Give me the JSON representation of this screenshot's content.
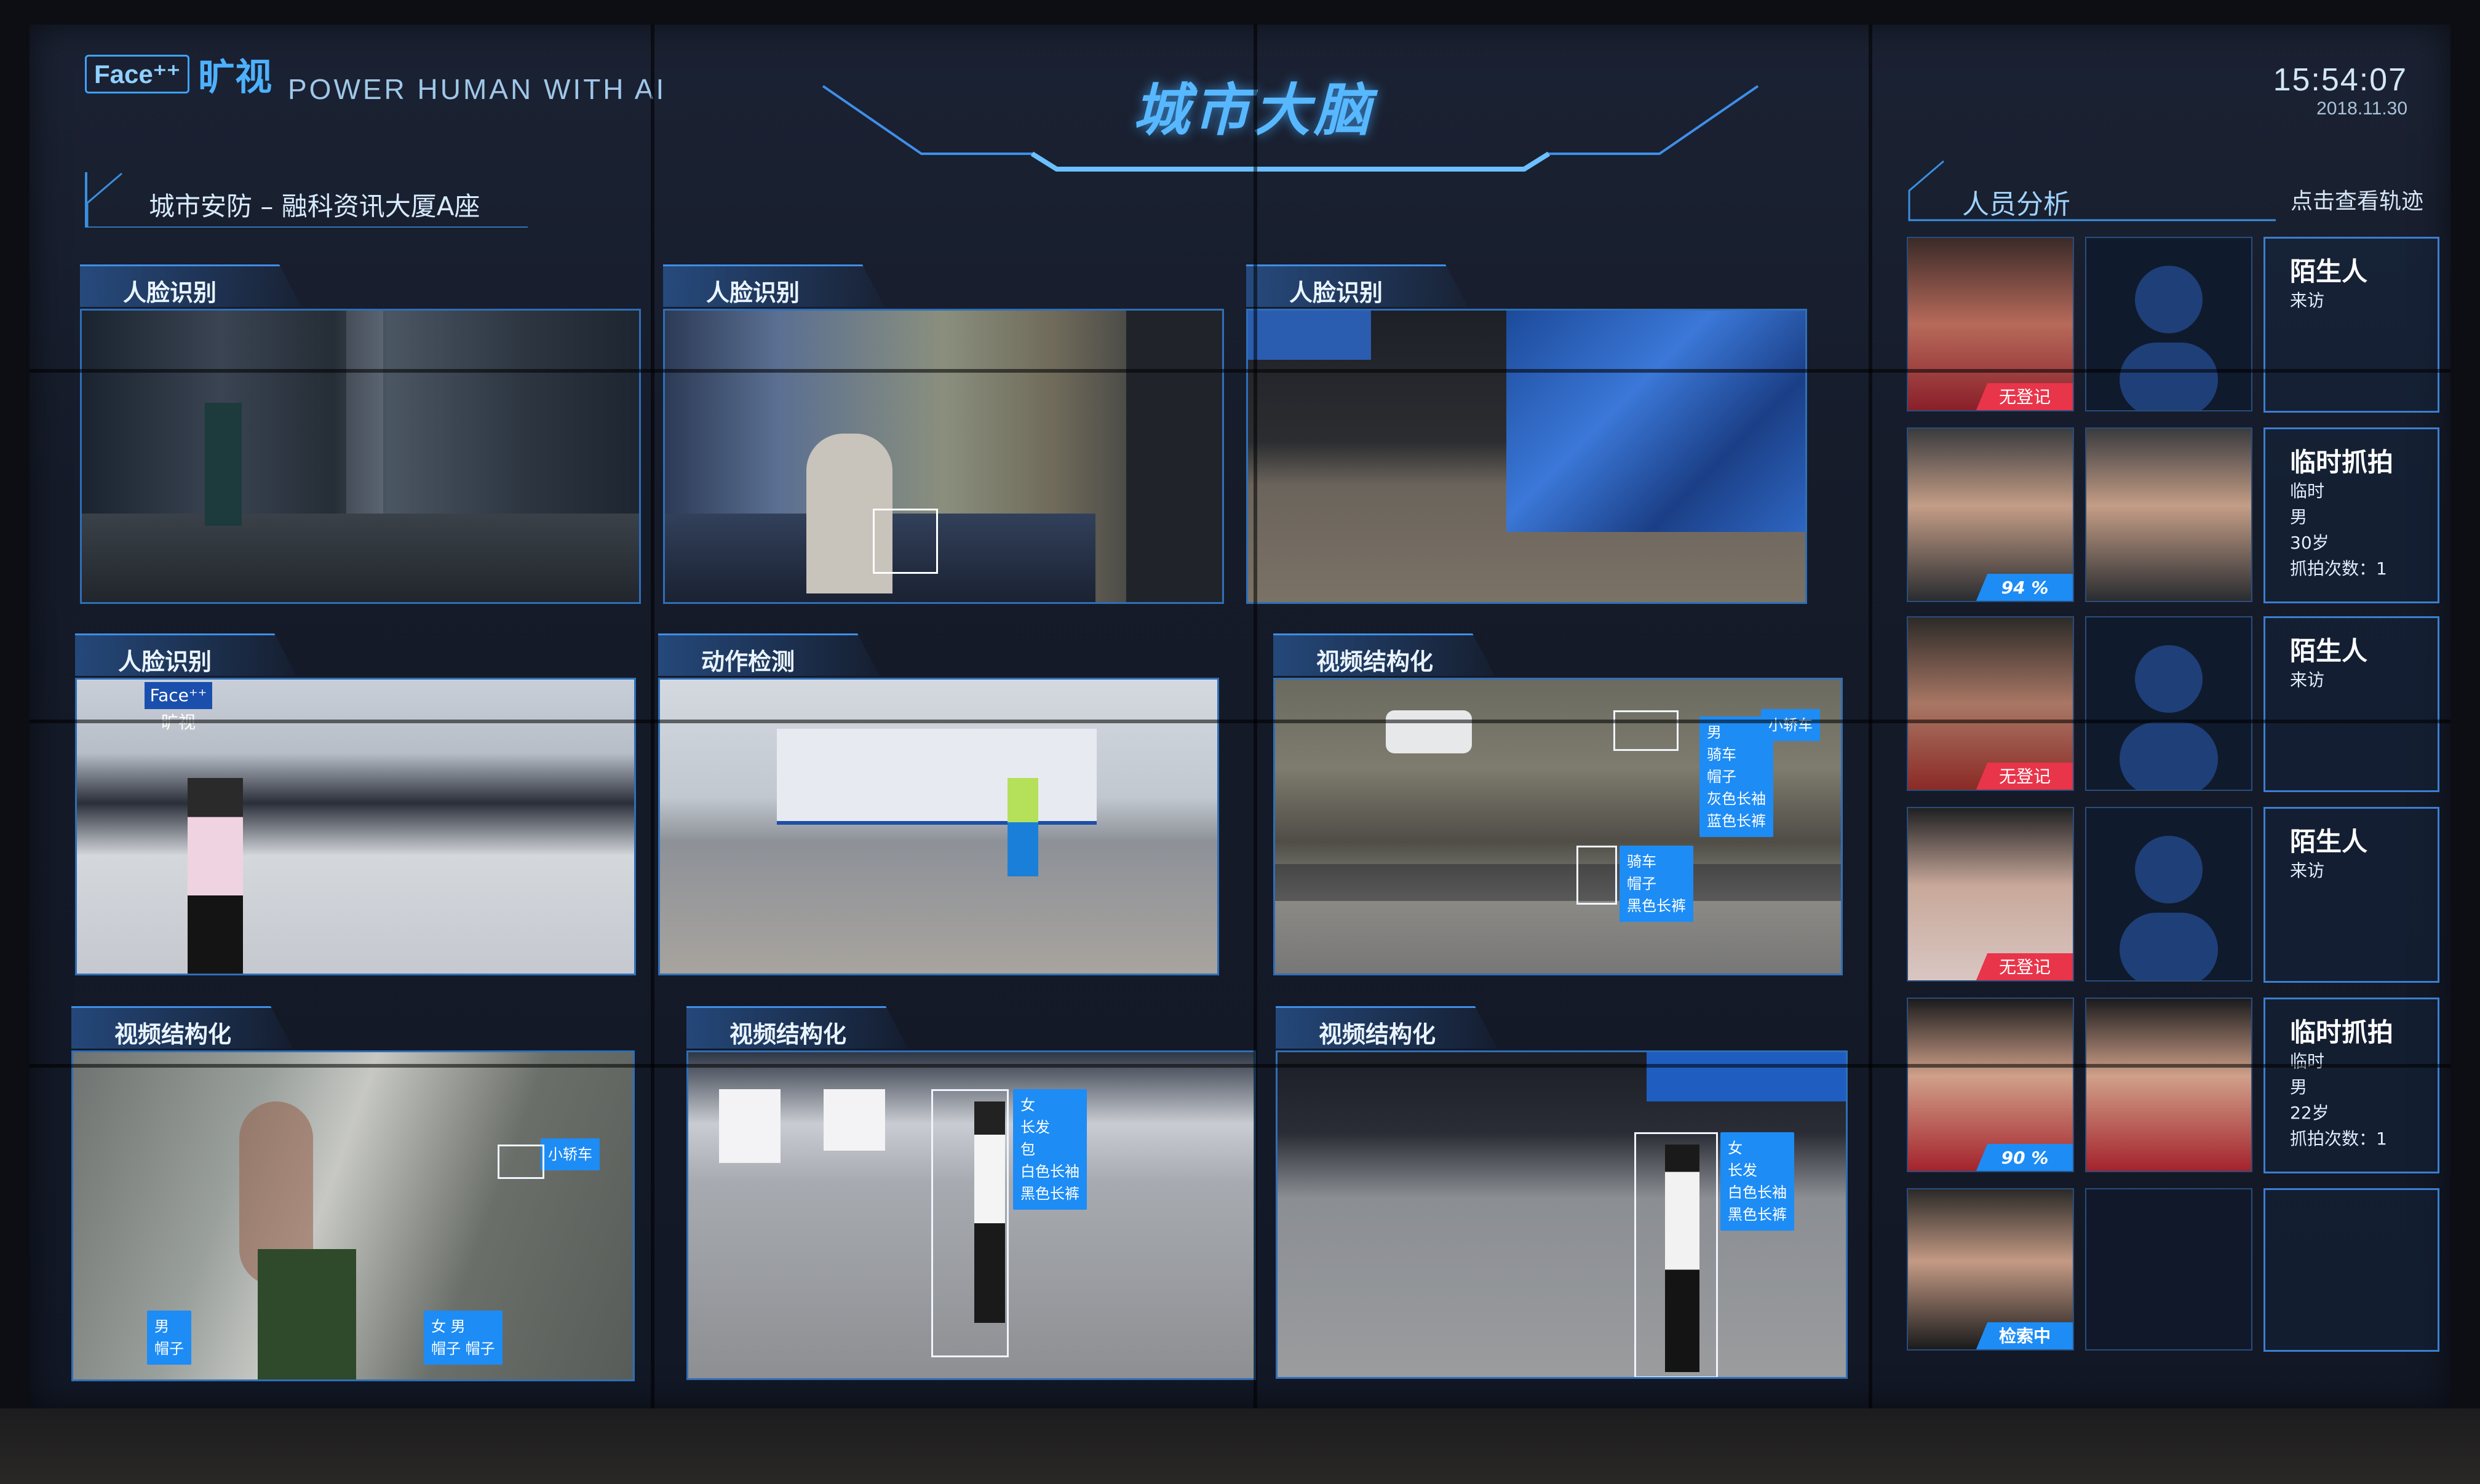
{
  "header": {
    "logo_badge": "Face⁺⁺",
    "brand_cn": "旷视",
    "tagline": "POWER HUMAN WITH AI",
    "main_title": "城市大脑",
    "clock_time": "15:54:07",
    "clock_date": "2018.11.30"
  },
  "section_title": "城市安防 – 融科资讯大厦A座",
  "right_panel": {
    "title": "人员分析",
    "action": "点击查看轨迹"
  },
  "tiles": [
    {
      "label": "人脸识别"
    },
    {
      "label": "人脸识别"
    },
    {
      "label": "人脸识别"
    },
    {
      "label": "人脸识别"
    },
    {
      "label": "动作检测"
    },
    {
      "label": "视频结构化"
    },
    {
      "label": "视频结构化"
    },
    {
      "label": "视频结构化"
    },
    {
      "label": "视频结构化"
    }
  ],
  "tags": {
    "t6_a": "男\n骑车\n帽子\n灰色长袖\n蓝色长裤",
    "t6_b": "骑车\n帽子\n黑色长裤",
    "t6_c": "小轿车",
    "t7_a": "小轿车",
    "t7_b": "男\n帽子",
    "t7_c": "女 男\n帽子 帽子",
    "t8": "女\n长发\n包\n白色长袖\n黑色长裤",
    "t9": "女\n长发\n白色长袖\n黑色长裤"
  },
  "persons": [
    {
      "type": "陌生人",
      "detail": "来访",
      "pill": "无登记"
    },
    {
      "type": "临时抓拍",
      "detail": "临时\n男\n30岁\n抓拍次数：1",
      "pill": "94 %"
    },
    {
      "type": "陌生人",
      "detail": "来访",
      "pill": "无登记"
    },
    {
      "type": "陌生人",
      "detail": "来访",
      "pill": "无登记"
    },
    {
      "type": "临时抓拍",
      "detail": "临时\n男\n22岁\n抓拍次数：1",
      "pill": "90 %"
    },
    {
      "type": "",
      "detail": "",
      "pill": "检索中"
    }
  ],
  "colors": {
    "accent": "#1d8cf5",
    "alert": "#e8354a",
    "title_glow": "#57b8ff"
  }
}
